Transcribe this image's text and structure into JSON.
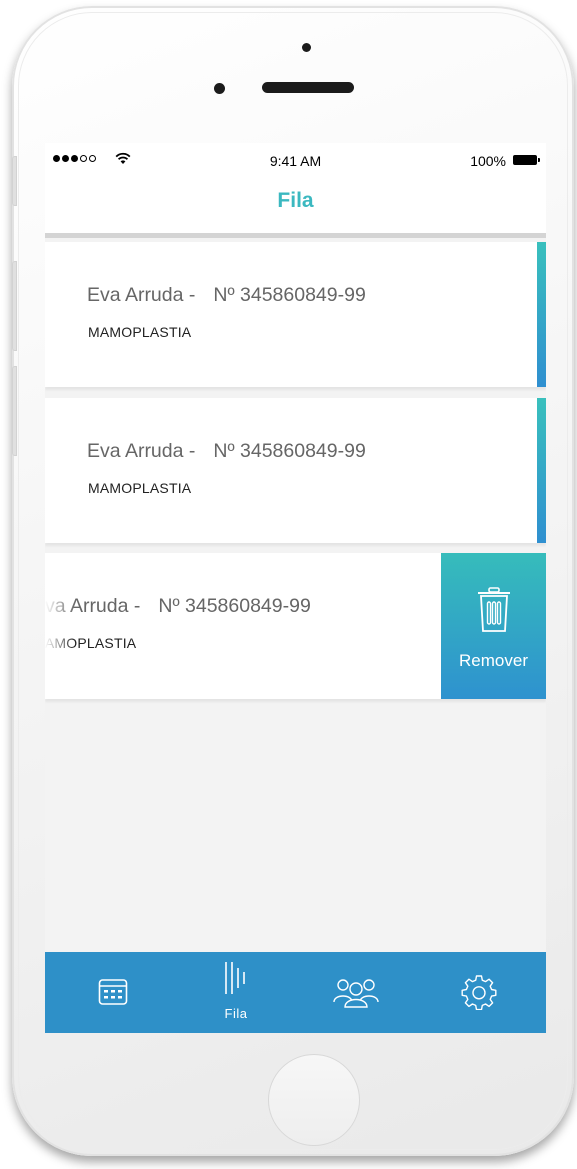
{
  "status_bar": {
    "time": "9:41 AM",
    "battery": "100%"
  },
  "nav": {
    "title": "Fila"
  },
  "queue": [
    {
      "name": "Eva Arruda -",
      "number": "Nº 345860849-99",
      "procedure": "MAMOPLASTIA"
    },
    {
      "name": "Eva Arruda -",
      "number": "Nº 345860849-99",
      "procedure": "MAMOPLASTIA"
    },
    {
      "name": "Eva Arruda -",
      "number": "Nº 345860849-99",
      "procedure": "MAMOPLASTIA"
    }
  ],
  "swipe_action": {
    "label": "Remover",
    "icon": "trash-icon"
  },
  "tabs": [
    {
      "icon": "calendar-icon",
      "label": ""
    },
    {
      "icon": "queue-bars-icon",
      "label": "Fila",
      "active": true
    },
    {
      "icon": "users-group-icon",
      "label": ""
    },
    {
      "icon": "gear-icon",
      "label": ""
    }
  ],
  "colors": {
    "accent": "#3bb8c0",
    "tab_bar": "#2e90c8",
    "background": "#f3f3f3"
  }
}
